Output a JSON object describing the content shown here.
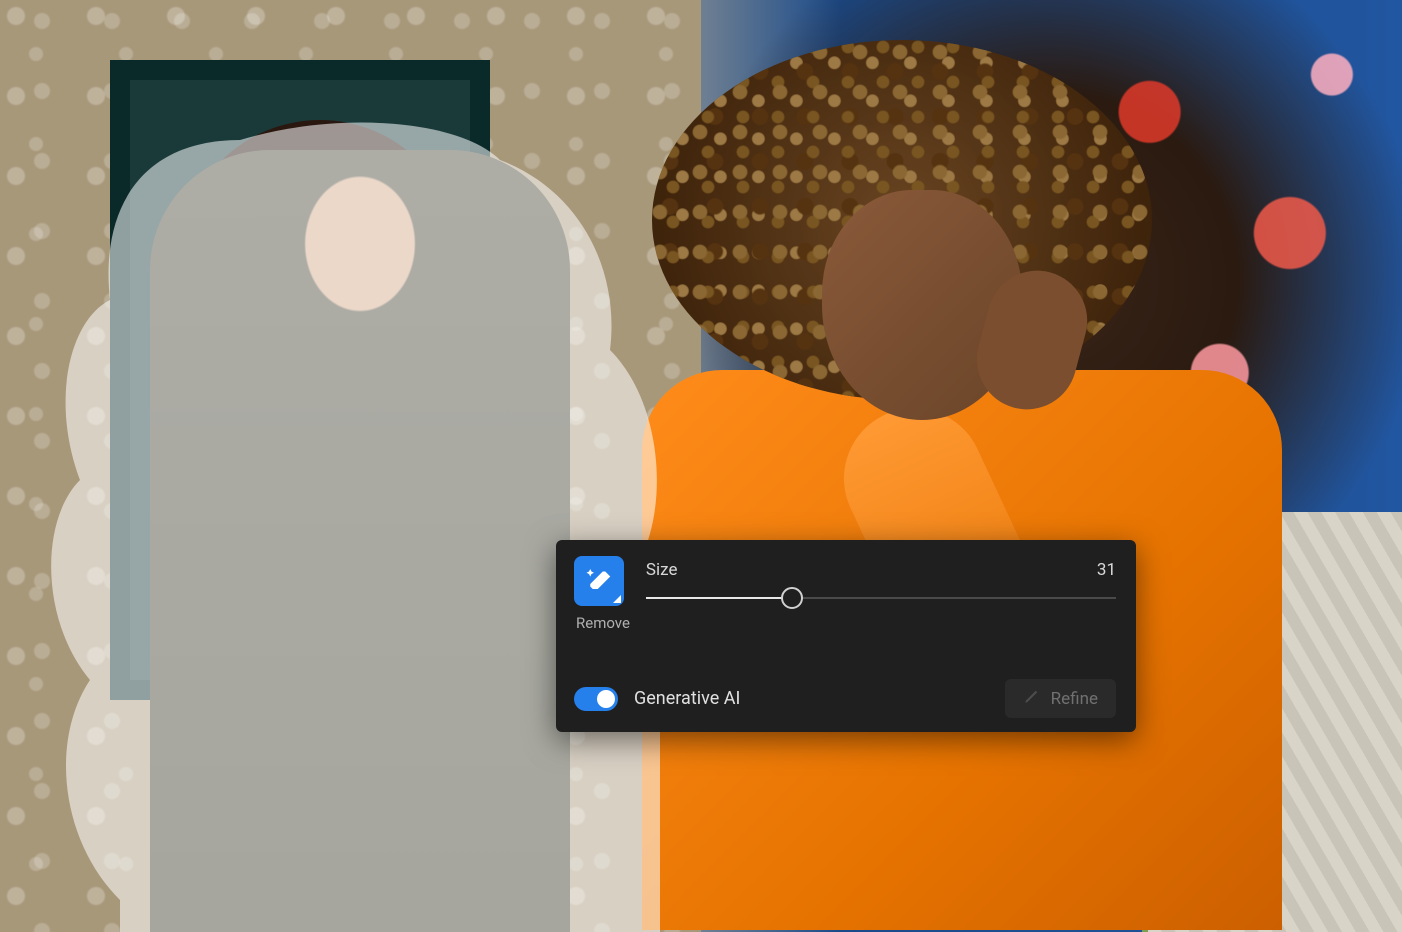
{
  "tool": {
    "icon_name": "eraser-sparkle-icon",
    "label": "Remove",
    "slider": {
      "label": "Size",
      "value": 31,
      "min": 0,
      "max": 100
    },
    "toggle": {
      "label": "Generative AI",
      "enabled": true
    },
    "refine": {
      "label": "Refine",
      "enabled": false
    }
  },
  "colors": {
    "accent": "#2680eb",
    "panel_bg": "#1f1f1f"
  }
}
